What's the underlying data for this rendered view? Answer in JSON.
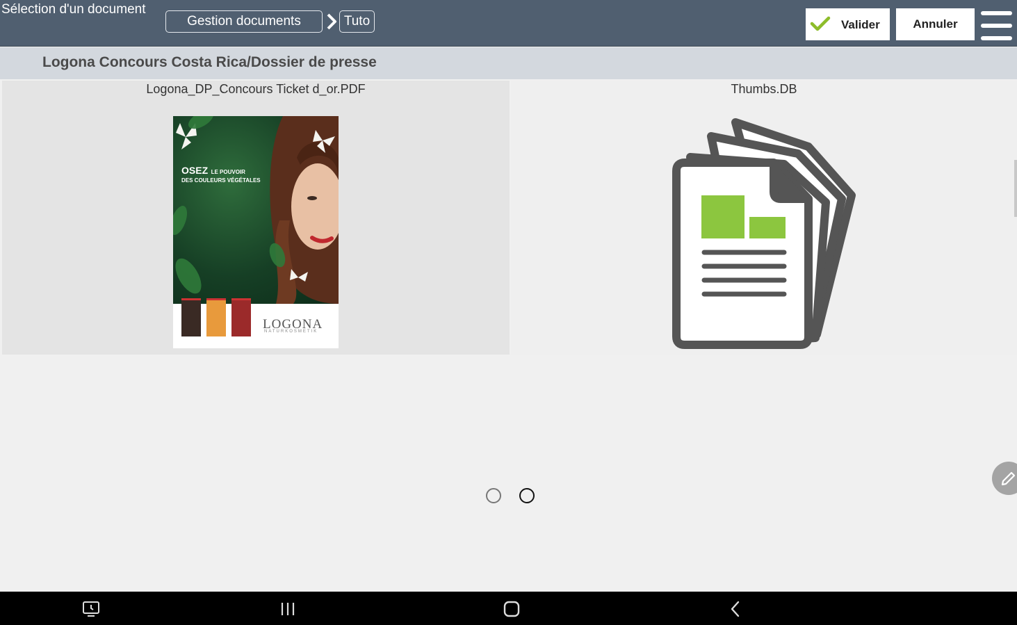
{
  "header": {
    "title": "Sélection d'un document",
    "breadcrumbs": [
      "Gestion documents",
      "Tuto"
    ],
    "valider_label": "Valider",
    "annuler_label": "Annuler"
  },
  "path": "Logona Concours Costa Rica/Dossier de presse",
  "files": [
    {
      "name": "Logona_DP_Concours Ticket d_or.PDF",
      "thumbnail": {
        "headline_big": "OSEZ",
        "headline_small": "LE POUVOIR",
        "headline_line2": "DES COULEURS VÉGÉTALES",
        "brand": "LOGONA",
        "brand_sub": "NATURKOSMETIK"
      }
    },
    {
      "name": "Thumbs.DB",
      "icon": "generic-document-icon"
    }
  ],
  "pagination": {
    "pages": 2,
    "current": 2
  },
  "colors": {
    "header_bg": "#505f70",
    "path_bar_bg": "#d3d8de",
    "check_green": "#8dbd2a",
    "doc_bar_green": "#8cc63f"
  },
  "navbar_icons": [
    "screen-icon",
    "recents-icon",
    "home-icon",
    "back-icon"
  ]
}
